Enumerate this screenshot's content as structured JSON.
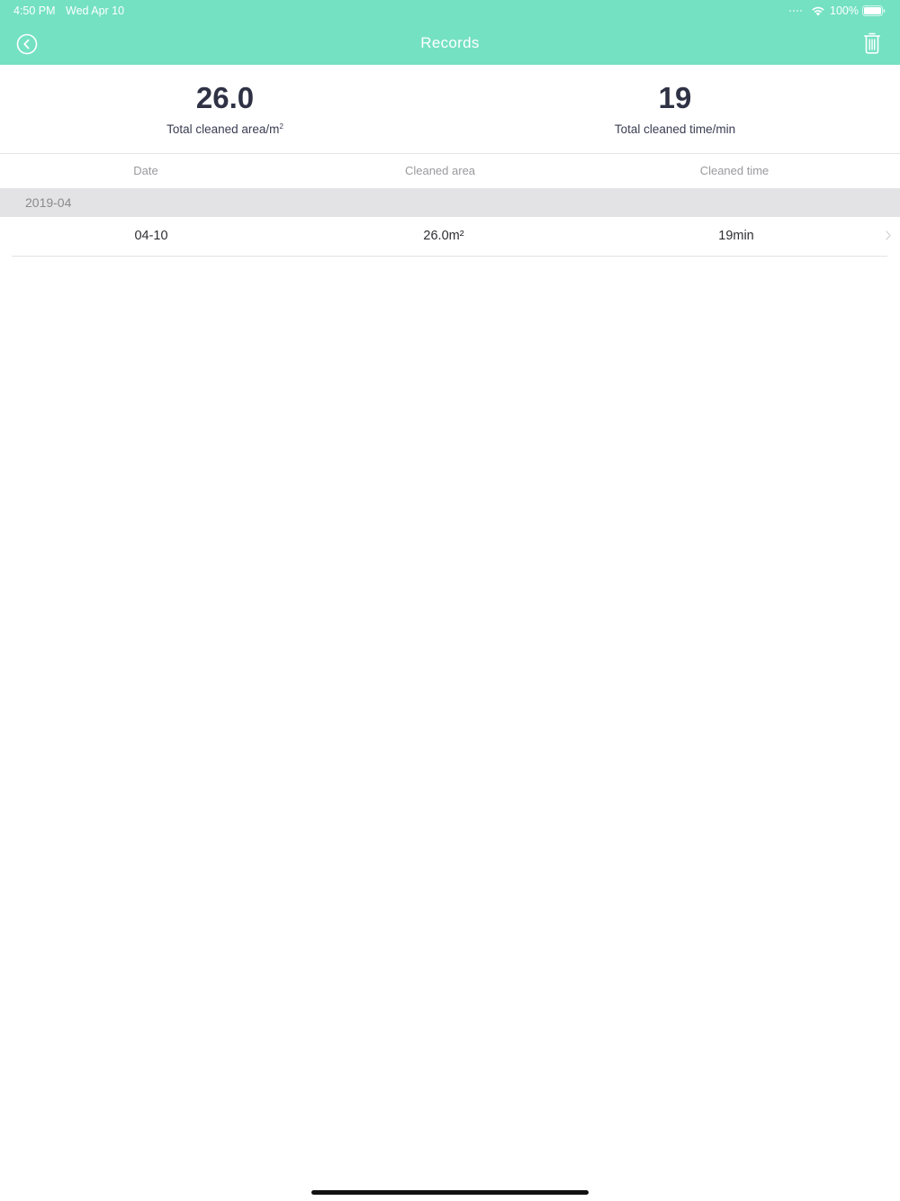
{
  "status_bar": {
    "time": "4:50 PM",
    "date": "Wed Apr 10",
    "battery": "100%",
    "wifi_icon": "wifi-icon",
    "battery_icon": "battery-icon"
  },
  "nav": {
    "title": "Records",
    "back_icon": "chevron-left-circle-icon",
    "delete_icon": "trash-icon"
  },
  "summary": {
    "area_value": "26.0",
    "area_label": "Total cleaned area/m",
    "area_label_sup": "2",
    "time_value": "19",
    "time_label": "Total cleaned time/min"
  },
  "table": {
    "columns": [
      "Date",
      "Cleaned area",
      "Cleaned time"
    ],
    "groups": [
      {
        "month": "2019-04",
        "rows": [
          {
            "date": "04-10",
            "area": "26.0m²",
            "time": "19min"
          }
        ]
      }
    ]
  },
  "colors": {
    "header": "#74e1c2",
    "section_bg": "#e3e3e6",
    "value_text": "#2f3245"
  }
}
